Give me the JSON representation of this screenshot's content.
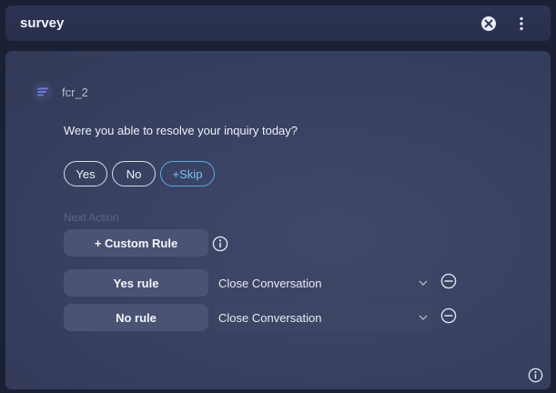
{
  "header": {
    "title": "survey",
    "icons": [
      "close-circle-icon",
      "more-vertical-icon"
    ]
  },
  "node": {
    "icon": "list-lines-icon",
    "name": "fcr_2",
    "question": "Were you able to resolve your inquiry today?",
    "options": [
      {
        "label": "Yes"
      },
      {
        "label": "No"
      },
      {
        "label": "+Skip",
        "accent": "#5aa9e6"
      }
    ],
    "next_action_label": "Next Action",
    "custom_rule_label": "+ Custom Rule",
    "rules": [
      {
        "label": "Yes rule",
        "action": "Close Conversation"
      },
      {
        "label": "No rule",
        "action": "Close Conversation"
      }
    ]
  },
  "colors": {
    "background": "#1b2035",
    "panel": "#394262",
    "rule_button": "#4b5374",
    "select": "#3d4565",
    "skip_accent": "#5aa9e6",
    "next_action_text": "#5c6585"
  }
}
